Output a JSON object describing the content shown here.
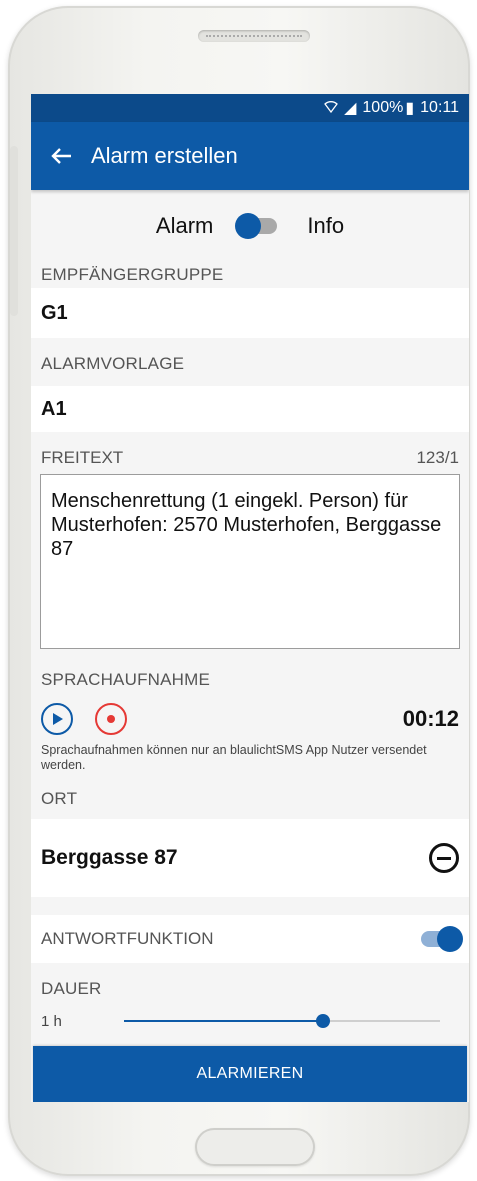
{
  "status": {
    "signal": "◢",
    "battery_pct": "100%",
    "battery_icon": "▮",
    "time": "10:11"
  },
  "appbar": {
    "title": "Alarm erstellen",
    "back_icon": "arrow-left"
  },
  "mode_toggle": {
    "left_label": "Alarm",
    "right_label": "Info",
    "state": "alarm"
  },
  "empfaengergruppe": {
    "label": "EMPFÄNGERGRUPPE",
    "value": "G1"
  },
  "alarmvorlage": {
    "label": "ALARMVORLAGE",
    "value": "A1"
  },
  "freitext": {
    "label": "FREITEXT",
    "counter": "123/1",
    "text": "Menschenrettung (1 eingekl. Person) für Musterhofen: 2570 Musterhofen, Berggasse 87"
  },
  "sprachaufnahme": {
    "label": "SPRACHAUFNAHME",
    "duration": "00:12",
    "note": "Sprachaufnahmen können nur an blaulichtSMS App Nutzer versendet werden."
  },
  "ort": {
    "label": "ORT",
    "value": "Berggasse 87"
  },
  "antwortfunktion": {
    "label": "ANTWORTFUNKTION",
    "enabled": true
  },
  "dauer": {
    "label": "DAUER",
    "value": "1 h",
    "slider_fraction": 0.63
  },
  "submit": {
    "label": "ALARMIEREN"
  },
  "colors": {
    "primary": "#0d5aa7",
    "statusbar": "#0c4a8a",
    "record": "#e53935"
  }
}
